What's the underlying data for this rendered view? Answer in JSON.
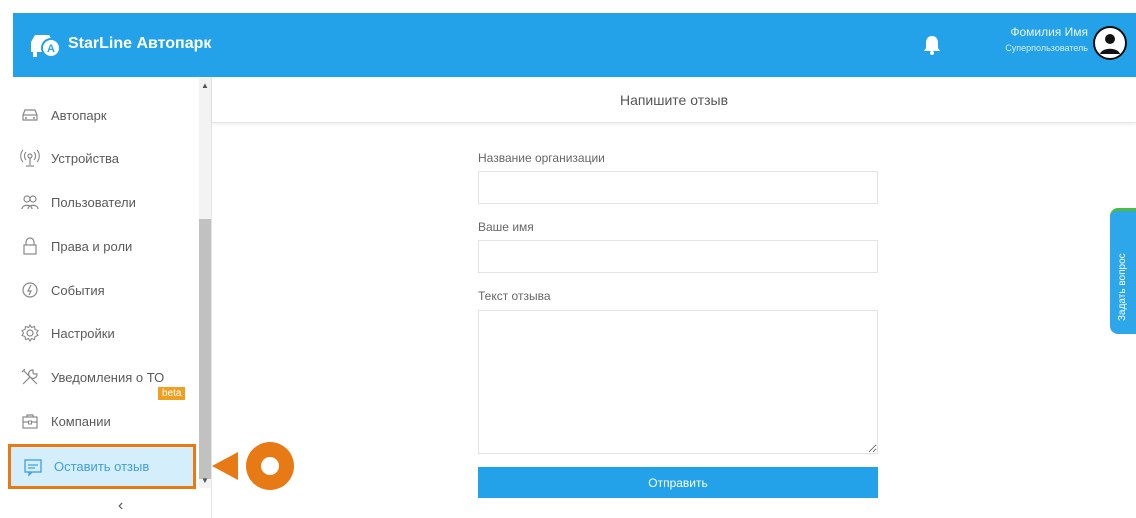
{
  "app": {
    "brand": "StarLine Автопарк"
  },
  "user": {
    "name": "Фомилия Имя",
    "role": "Суперпользователь"
  },
  "sidebar": {
    "items": [
      {
        "label": "Автопарк",
        "icon": "car-icon"
      },
      {
        "label": "Устройства",
        "icon": "device-signal-icon"
      },
      {
        "label": "Пользователи",
        "icon": "users-icon"
      },
      {
        "label": "Права и роли",
        "icon": "lock-icon"
      },
      {
        "label": "События",
        "icon": "events-icon"
      },
      {
        "label": "Настройки",
        "icon": "gear-icon"
      },
      {
        "label": "Уведомления о ТО",
        "icon": "wrench-icon",
        "badge": "beta"
      },
      {
        "label": "Компании",
        "icon": "company-icon"
      }
    ],
    "active": {
      "label": "Оставить отзыв",
      "icon": "feedback-icon"
    },
    "collapse": "‹"
  },
  "main": {
    "title": "Напишите отзыв",
    "form": {
      "org_label": "Название организации",
      "org_value": "",
      "name_label": "Ваше имя",
      "name_value": "",
      "text_label": "Текст отзыва",
      "text_value": "",
      "submit_label": "Отправить"
    }
  },
  "ask_question": "Задать вопрос",
  "colors": {
    "brand_blue": "#23a2ea",
    "highlight_orange": "#e77a14",
    "beta_badge": "#f0a020"
  }
}
